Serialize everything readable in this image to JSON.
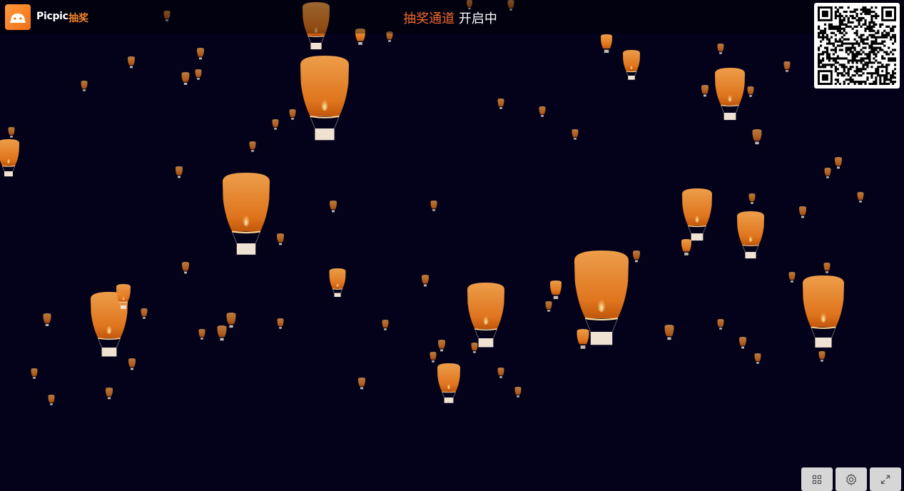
{
  "header": {
    "brand": "Picpic",
    "brand_sub": "抽奖",
    "title_accent": "抽奖通道",
    "title_rest": "开启中"
  },
  "icons": {
    "logo": "picpic-logo-icon",
    "qr": "qr-code",
    "controls": [
      "grid-icon",
      "gear-icon",
      "expand-icon"
    ]
  },
  "colors": {
    "background": "#03021a",
    "accent": "#f36a2a",
    "lantern_top": "#f7a24a",
    "lantern_bottom": "#d9620f",
    "lantern_base": "#efe2d2"
  }
}
